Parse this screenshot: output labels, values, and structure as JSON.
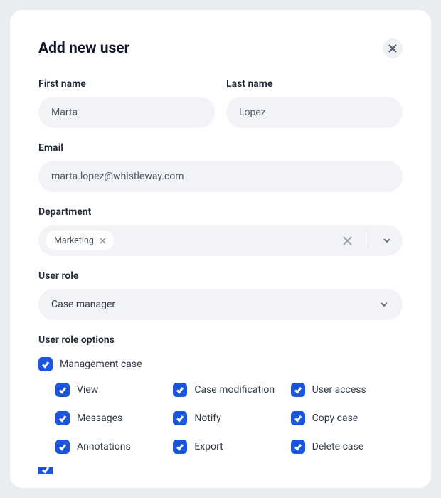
{
  "title": "Add new user",
  "fields": {
    "first_name": {
      "label": "First name",
      "value": "Marta"
    },
    "last_name": {
      "label": "Last name",
      "value": "Lopez"
    },
    "email": {
      "label": "Email",
      "value": "marta.lopez@whistleway.com"
    }
  },
  "department": {
    "label": "Department",
    "tags": [
      "Marketing"
    ]
  },
  "role": {
    "label": "User role",
    "value": "Case manager"
  },
  "options": {
    "label": "User role options",
    "parent": "Management case",
    "items": [
      "View",
      "Case modification",
      "User access",
      "Messages",
      "Notify",
      "Copy case",
      "Annotations",
      "Export",
      "Delete case"
    ]
  }
}
